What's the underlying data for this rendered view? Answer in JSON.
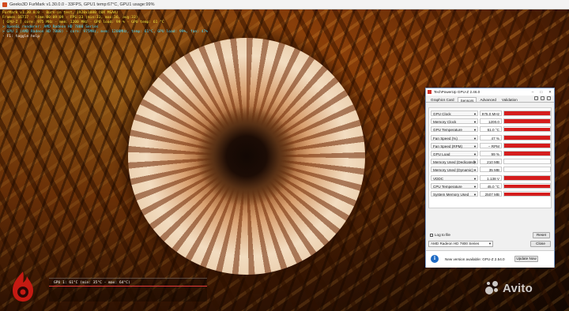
{
  "furmark": {
    "window_title": "Geeks3D FurMark v1.30.0.0 - 33FPS, GPU1 temp:67°C, GPU1 usage:99%",
    "overlay": [
      "FurMark v1.30.0.0 - Burn-in test, 1920x1080 (0X MSAA)",
      "Frames:16717 - time:00:09:09 - FPS:33 (min:33, max:36, avg:33)",
      "[ GPU-Z ] core: 975 MHz - mem: 1200 MHz - GPU load: 99 % - GPU temp: 61 °C",
      "> OpenGL renderer: AMD Radeon HD 7800 Series",
      "> GPU 1 (AMD Radeon HD 7800) - core: 975MHz, mem: 1200MHz, temp: 61°C, GPU load: 99%, fan: 47%",
      "- F1: toggle help"
    ],
    "graph_label": "GPU 1: 61°C (min: 35°C - max: 64°C)"
  },
  "gpuz": {
    "title": "TechPowerUp GPU-Z 2.46.0",
    "window_buttons": [
      "–",
      "□",
      "✕"
    ],
    "tabs": [
      "Graphics Card",
      "Sensors",
      "Advanced",
      "Validation"
    ],
    "active_tab": "Sensors",
    "sensors": [
      {
        "name": "GPU Clock",
        "value": "975.0 MHz",
        "level": 0.95
      },
      {
        "name": "Memory Clock",
        "value": "1200.0 MHz",
        "level": 0.95
      },
      {
        "name": "GPU Temperature",
        "value": "61.0 °C",
        "level": 0.9
      },
      {
        "name": "Fan Speed (%)",
        "value": "47 %",
        "level": 0.9
      },
      {
        "name": "Fan Speed (RPM)",
        "value": "– RPM",
        "level": 0.9
      },
      {
        "name": "GPU Load",
        "value": "99 %",
        "level": 1.0
      },
      {
        "name": "Memory Used (Dedicated)",
        "value": "210 MB",
        "level": 0.05
      },
      {
        "name": "Memory Used (Dynamic)",
        "value": "35 MB",
        "level": 0.03
      },
      {
        "name": "VDDC",
        "value": "1.138 V",
        "level": 0.9
      },
      {
        "name": "CPU Temperature",
        "value": "45.0 °C",
        "level": 0.85
      },
      {
        "name": "System Memory Used",
        "value": "2507 MB",
        "level": 0.9
      }
    ],
    "log_to_file_label": "Log to file",
    "reset_label": "Reset",
    "gpu_select": "AMD Radeon HD 7800 Series",
    "close_label": "Close",
    "update_text": "New version available: GPU-Z 2.54.0",
    "update_button": "Update Now",
    "accent_red": "#d51d1d"
  },
  "watermark": {
    "text": "Avito"
  }
}
